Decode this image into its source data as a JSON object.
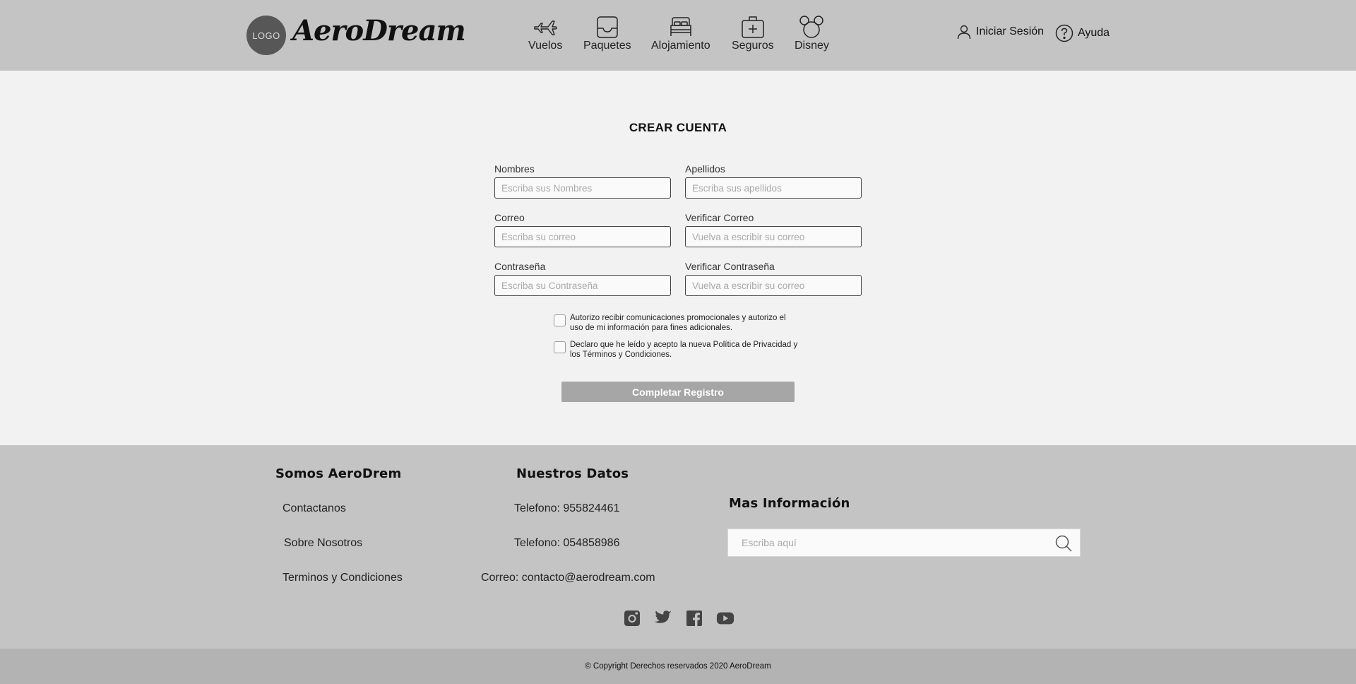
{
  "header": {
    "logo_text": "LOGO",
    "brand": "AeroDream",
    "nav": [
      {
        "label": "Vuelos",
        "icon": "plane-icon"
      },
      {
        "label": "Paquetes",
        "icon": "package-icon"
      },
      {
        "label": "Alojamiento",
        "icon": "bed-icon"
      },
      {
        "label": "Seguros",
        "icon": "medical-kit-icon"
      },
      {
        "label": "Disney",
        "icon": "mouse-ears-icon"
      }
    ],
    "login_label": "Iniciar Sesión",
    "help_label": "Ayuda"
  },
  "form": {
    "title": "CREAR CUENTA",
    "fields": [
      {
        "label": "Nombres",
        "placeholder": "Escriba sus Nombres"
      },
      {
        "label": "Apellidos",
        "placeholder": "Escriba sus apellidos"
      },
      {
        "label": "Correo",
        "placeholder": "Escriba su correo"
      },
      {
        "label": "Verificar Correo",
        "placeholder": "Vuelva a escribir su correo"
      },
      {
        "label": "Contraseña",
        "placeholder": "Escriba su Contraseña"
      },
      {
        "label": "Verificar Contraseña",
        "placeholder": "Vuelva a escribir su correo"
      }
    ],
    "checkboxes": [
      {
        "line1": "Autorizo recibir comunicaciones promocionales y autorizo el",
        "line2": "uso de mi información para fines adicionales."
      },
      {
        "line1": "Declaro que he leído y acepto la nueva Política de Privacidad y",
        "line2": "los Términos y Condiciones."
      }
    ],
    "submit_label": "Completar Registro"
  },
  "footer": {
    "col1_title": "Somos AeroDrem",
    "col1_links": [
      "Contactanos",
      "Sobre Nosotros",
      "Terminos y Condiciones"
    ],
    "col2_title": "Nuestros Datos",
    "col2_items": [
      "Telefono: 955824461",
      "Telefono: 054858986",
      "Correo: contacto@aerodream.com"
    ],
    "col3_title": "Mas Información",
    "search_placeholder": "Escriba aquí",
    "social": [
      "instagram-icon",
      "twitter-icon",
      "facebook-icon",
      "youtube-icon"
    ],
    "copyright": "© Copyright Derechos reservados 2020 AeroDream"
  },
  "colors": {
    "header_bg": "#c4c4c4",
    "page_bg": "#f2f2f2",
    "button_bg": "#a6a6a6",
    "copyright_bg": "#b3b3b3"
  }
}
